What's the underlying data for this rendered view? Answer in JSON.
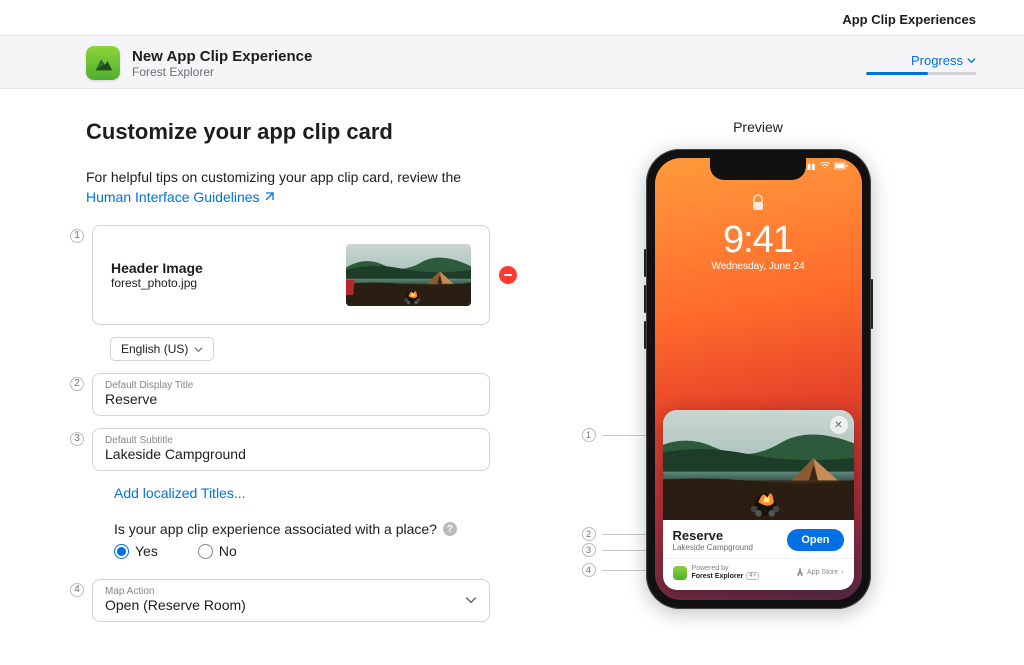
{
  "breadcrumb": "App Clip Experiences",
  "header": {
    "title": "New App Clip Experience",
    "subtitle": "Forest Explorer",
    "progress_label": "Progress"
  },
  "page": {
    "title": "Customize your app clip card",
    "intro": "For helpful tips on customizing your app clip card, review the",
    "hig_link": "Human Interface Guidelines"
  },
  "form": {
    "header_image": {
      "label": "Header Image",
      "filename": "forest_photo.jpg"
    },
    "language": "English (US)",
    "display_title": {
      "label": "Default Display Title",
      "value": "Reserve"
    },
    "subtitle": {
      "label": "Default Subtitle",
      "value": "Lakeside Campground"
    },
    "localized_link": "Add localized Titles...",
    "place_question": "Is your app clip experience associated with a place?",
    "yes": "Yes",
    "no": "No",
    "map_action": {
      "label": "Map Action",
      "value": "Open (Reserve Room)"
    }
  },
  "preview": {
    "label": "Preview",
    "time": "9:41",
    "date": "Wednesday, June 24",
    "card_title": "Reserve",
    "card_subtitle": "Lakeside Campground",
    "open_button": "Open",
    "powered_by": "Powered by",
    "app_name": "Forest Explorer",
    "appstore": "App Store"
  }
}
